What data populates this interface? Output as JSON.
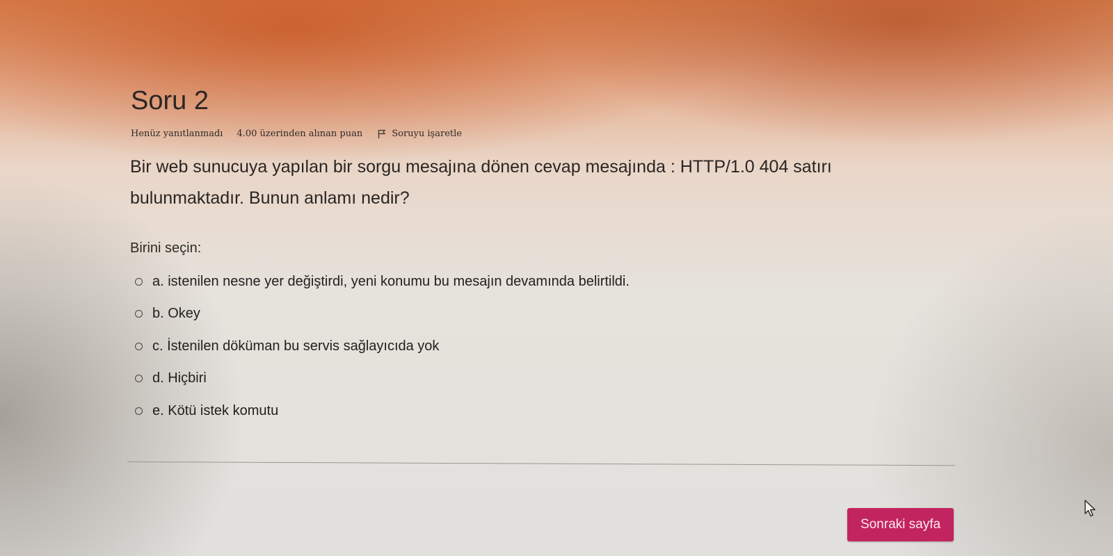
{
  "question": {
    "title": "Soru 2",
    "state": "Henüz yanıtlanmadı",
    "grade": "4.00 üzerinden alınan puan",
    "flag_label": "Soruyu işaretle",
    "text": "Bir web sunucuya yapılan bir sorgu mesajına dönen cevap mesajında : HTTP/1.0 404 satırı bulunmaktadır. Bunun anlamı nedir?",
    "prompt": "Birini seçin:",
    "answers": [
      "a. istenilen nesne yer değiştirdi, yeni konumu bu mesajın devamında belirtildi.",
      "b. Okey",
      "c. İstenilen döküman bu servis sağlayıcıda yok",
      "d. Hiçbiri",
      "e. Kötü istek komutu"
    ],
    "selected": null
  },
  "navigation": {
    "next_label": "Sonraki sayfa"
  },
  "icons": {
    "flag": "flag-icon",
    "radio": "radio-icon",
    "cursor": "mouse-pointer-icon"
  },
  "colors": {
    "accent": "#c2245f"
  }
}
